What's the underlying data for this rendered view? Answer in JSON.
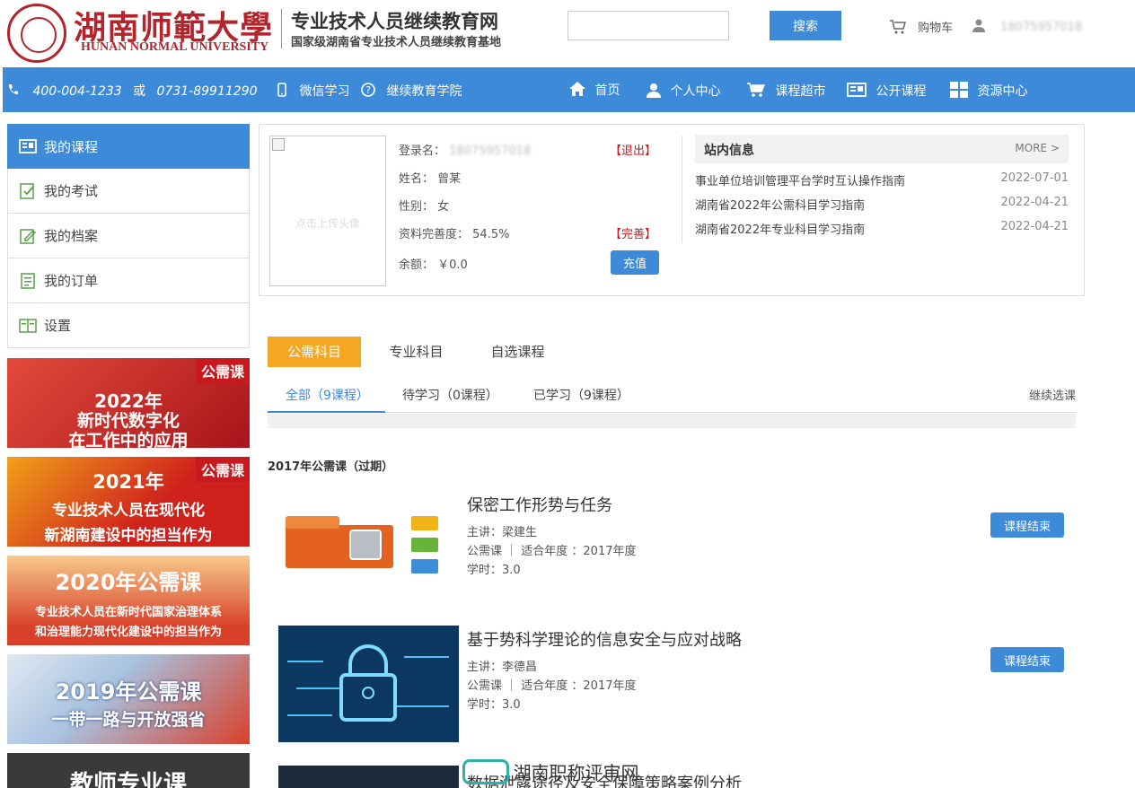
{
  "header": {
    "logo_cn": "湖南师範大學",
    "logo_en": "HUNAN NORMAL UNIVERSITY",
    "site_title": "专业技术人员继续教育网",
    "site_subtitle": "国家级湖南省专业技术人员继续教育基地",
    "search_placeholder": "",
    "search_button": "搜索",
    "cart_label": "购物车",
    "user_phone": "18075957018"
  },
  "navbar": {
    "phone1": "400-004-1233",
    "or": "或",
    "phone2": "0731-89911290",
    "wechat": "微信学习",
    "college": "继续教育学院",
    "home": "首页",
    "personal": "个人中心",
    "market": "课程超市",
    "public": "公开课程",
    "resource": "资源中心"
  },
  "sidebar": {
    "items": [
      {
        "label": "我的课程"
      },
      {
        "label": "我的考试"
      },
      {
        "label": "我的档案"
      },
      {
        "label": "我的订单"
      },
      {
        "label": "设置"
      }
    ]
  },
  "banners": [
    {
      "tag": "公需课",
      "line1": "2022年",
      "line2": "新时代数字化",
      "line3": "在工作中的应用",
      "color": "#c0282b"
    },
    {
      "tag": "公需课",
      "line1": "2021年",
      "line2": "专业技术人员在现代化",
      "line3": "新湖南建设中的担当作为",
      "color": "#d9261c"
    },
    {
      "tag": "",
      "line1": "2020年公需课",
      "line2": "专业技术人员在新时代国家治理体系",
      "line3": "和治理能力现代化建设中的担当作为",
      "color": "#d8402a"
    },
    {
      "tag": "",
      "line1": "2019年公需课",
      "line2": "一带一路与开放强省",
      "line3": "",
      "color": "#2a5aa6"
    },
    {
      "tag": "",
      "line1": "教师专业课",
      "line2": "",
      "line3": "",
      "color": "#3a3a3a"
    }
  ],
  "profile": {
    "avatar_hint": "点击上传头像",
    "login_label": "登录名：",
    "login_value": "18075957018",
    "logout": "【退出】",
    "name_label": "姓名：",
    "name_value": "曾某",
    "gender_label": "性别：",
    "gender_value": "女",
    "completion_label": "资料完善度：",
    "completion_value": "54.5%",
    "complete_link": "【完善】",
    "balance_label": "余额：",
    "balance_value": "￥0.0",
    "recharge": "充值"
  },
  "news": {
    "title": "站内信息",
    "more": "MORE >",
    "items": [
      {
        "text": "事业单位培训管理平台学时互认操作指南",
        "date": "2022-07-01"
      },
      {
        "text": "湖南省2022年公需科目学习指南",
        "date": "2022-04-21"
      },
      {
        "text": "湖南省2022年专业科目学习指南",
        "date": "2022-04-21"
      }
    ]
  },
  "tabs": [
    {
      "label": "公需科目"
    },
    {
      "label": "专业科目"
    },
    {
      "label": "自选课程"
    }
  ],
  "subtabs": [
    {
      "label": "全部（9课程）"
    },
    {
      "label": "待学习（0课程）"
    },
    {
      "label": "已学习（9课程）"
    }
  ],
  "continue_select": "继续选课",
  "section_title": "2017年公需课（过期）",
  "courses": [
    {
      "title": "保密工作形势与任务",
      "teacher": "主讲：梁建生",
      "category": "公需课 ｜  适合年度 ：2017年度",
      "hours": "学时：3.0",
      "button": "课程结束"
    },
    {
      "title": "基于势科学理论的信息安全与应对战略",
      "teacher": "主讲：李德昌",
      "category": "公需课 ｜  适合年度 ：2017年度",
      "hours": "学时：3.0",
      "button": "课程结束"
    },
    {
      "title": "数据泄露途径及安全保障策略案例分析",
      "teacher": "",
      "category": "",
      "hours": "",
      "button": ""
    }
  ],
  "watermark": "湖南职称评审网",
  "colors": {
    "primary": "#3d8ad9",
    "accent": "#f5a623",
    "brand_red": "#b3242c"
  }
}
